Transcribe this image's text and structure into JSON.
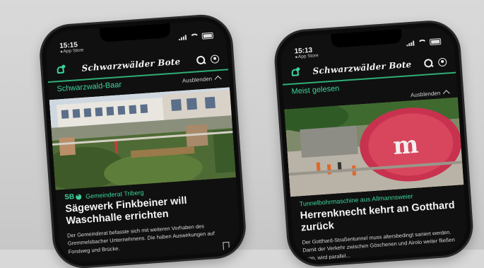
{
  "phones": [
    {
      "status": {
        "time": "15:15",
        "back_label": "◂ App Store"
      },
      "header": {
        "brand": "Schwarzwälder Bote"
      },
      "section": {
        "title": "Schwarzwald-Baar",
        "hide_label": "Ausblenden"
      },
      "article": {
        "badge": "SB",
        "topic": "Gemeinderat Triberg",
        "headline": "Sägewerk Finkbeiner will Waschhalle errichten",
        "teaser": "Der Gemeinderat befasste sich mit weiteren Vorhaben des Gremmelsbacher Unternehmens. Die haben Auswirkungen auf Forstweg und Brücke."
      }
    },
    {
      "status": {
        "time": "15:13",
        "back_label": "◂ App Store"
      },
      "header": {
        "brand": "Schwarzwälder Bote"
      },
      "section": {
        "title": "Meist gelesen",
        "hide_label": "Ausblenden"
      },
      "article": {
        "topic": "Tunnelbohrmaschine aus Allmannsweier",
        "headline": "Herrenknecht kehrt an Gotthard zurück",
        "teaser": "Der Gotthard-Straßentunnel muss altersbedingt saniert werden. Damit der Verkehr zwischen Göschenen und Airolo weiter fließen kann, wird parallel..."
      }
    }
  ],
  "colors": {
    "accent": "#3dd39a",
    "screen": "#101010"
  }
}
